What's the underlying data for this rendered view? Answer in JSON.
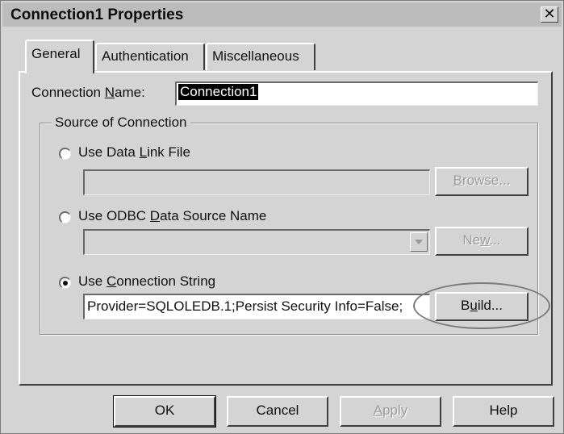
{
  "window": {
    "title": "Connection1 Properties",
    "close_glyph": "✕"
  },
  "tabs": [
    {
      "label": "General",
      "active": true
    },
    {
      "label": "Authentication",
      "active": false
    },
    {
      "label": "Miscellaneous",
      "active": false
    }
  ],
  "connection_name": {
    "label_pre": "Connection ",
    "label_mnemonic": "N",
    "label_post": "ame:",
    "value": "Connection1"
  },
  "source_group": {
    "legend": "Source of Connection",
    "selected_option": "Use Connection String",
    "data_link": {
      "label_pre": "Use Data ",
      "label_mnemonic": "L",
      "label_post": "ink File",
      "value": "",
      "browse_pre": "",
      "browse_mnemonic": "B",
      "browse_post": "rowse..."
    },
    "odbc": {
      "label_pre": "Use ODBC ",
      "label_mnemonic": "D",
      "label_post": "ata Source Name",
      "value": "",
      "new_pre": "Ne",
      "new_mnemonic": "w",
      "new_post": "..."
    },
    "connection_string": {
      "label_pre": "Use ",
      "label_mnemonic": "C",
      "label_post": "onnection String",
      "value": "Provider=SQLOLEDB.1;Persist Security Info=False;",
      "build_pre": "B",
      "build_mnemonic": "u",
      "build_post": "ild..."
    }
  },
  "footer": {
    "ok_label": "OK",
    "cancel_label": "Cancel",
    "apply_pre": "",
    "apply_mnemonic": "A",
    "apply_post": "pply",
    "help_label": "Help"
  },
  "colors": {
    "dialog_bg": "#d4d4d4",
    "titlebar_bg": "#bcbcbc",
    "selection_bg": "#000000",
    "selection_fg": "#ffffff",
    "disabled_text": "#9a9a9a"
  }
}
